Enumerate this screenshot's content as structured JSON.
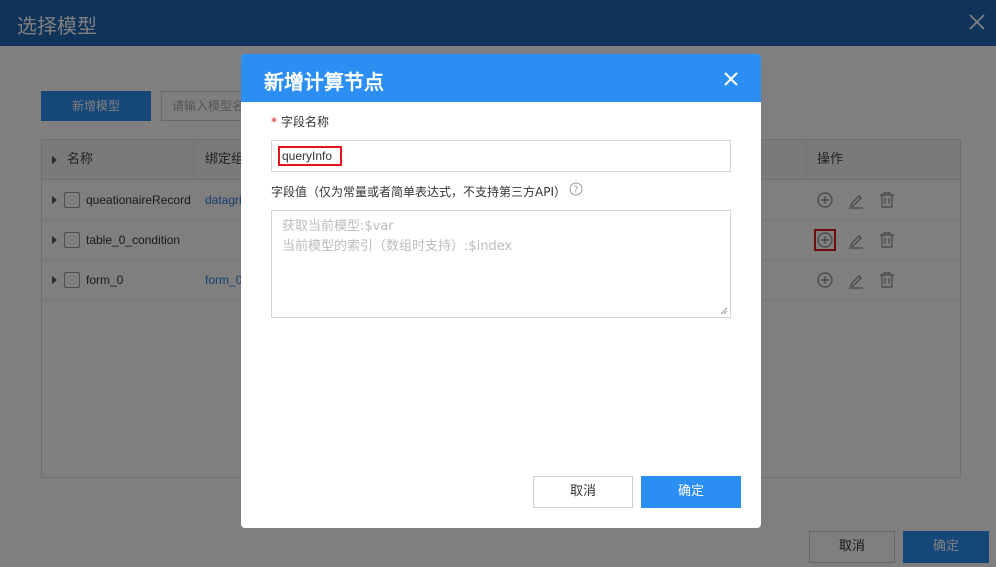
{
  "outer": {
    "title": "选择模型",
    "add_button": "新增模型",
    "search_placeholder": "请输入模型名",
    "columns": [
      "名称",
      "绑定组",
      "操作"
    ],
    "rows": [
      {
        "name": "queationaireRecord",
        "bind": "datagri"
      },
      {
        "name": "table_0_condition",
        "bind": ""
      },
      {
        "name": "form_0",
        "bind": "form_0"
      }
    ],
    "cancel_label": "取消",
    "ok_label": "确定"
  },
  "modal": {
    "title": "新增计算节点",
    "field_name_label": "字段名称",
    "field_name_value": "queryInfo",
    "field_value_label": "字段值（仅为常量或者简单表达式，不支持第三方API）",
    "textarea_placeholder": [
      "获取当前模型:$var",
      "当前模型的索引（数组时支持）:$index"
    ],
    "cancel_label": "取消",
    "ok_label": "确定"
  },
  "colors": {
    "header_blue": "#1f67b3",
    "primary": "#2b8ef3",
    "highlight_red": "#e0161e",
    "link_blue": "#2b7ed8"
  },
  "icons": [
    "close-icon",
    "caret-right-icon",
    "checkbox",
    "add-circle-icon",
    "edit-icon",
    "delete-icon",
    "help-icon"
  ]
}
